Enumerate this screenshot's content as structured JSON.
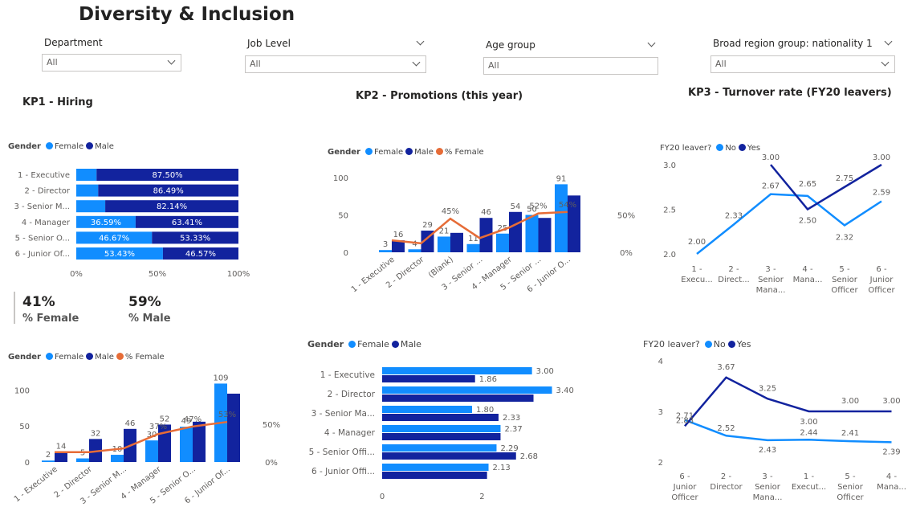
{
  "title": "Diversity & Inclusion",
  "filters": [
    {
      "label": "Department",
      "value": "All"
    },
    {
      "label": "Job Level",
      "value": "All"
    },
    {
      "label": "Age group",
      "value": "All"
    },
    {
      "label": "Broad region group: nationality 1",
      "value": "All"
    }
  ],
  "sections": {
    "kp1": "KP1 - Hiring",
    "kp2": "KP2 - Promotions (this year)",
    "kp3": "KP3 - Turnover rate (FY20 leavers)"
  },
  "colors": {
    "female": "#118dff",
    "male": "#12239e",
    "pct_female": "#e66c37",
    "light_blue": "#8fc4f5",
    "axis_text": "#605e5c"
  },
  "legends": {
    "gender": "Gender",
    "female": "Female",
    "male": "Male",
    "pct_female": "% Female",
    "fy20": "FY20 leaver?",
    "no": "No",
    "yes": "Yes"
  },
  "cards": {
    "female_value": "41%",
    "female_label": "% Female",
    "male_value": "59%",
    "male_label": "% Male"
  },
  "chart_data": [
    {
      "id": "hiring-stacked-100",
      "type": "bar",
      "orientation": "horizontal",
      "stacked_percent": true,
      "categories": [
        "1 - Executive",
        "2 - Director",
        "3 - Senior M...",
        "4 - Manager",
        "5 - Senior O...",
        "6 - Junior Of..."
      ],
      "series": [
        {
          "name": "Female",
          "values": [
            12.5,
            13.51,
            17.86,
            36.59,
            46.67,
            53.43
          ],
          "labels": [
            "",
            "",
            "",
            "36.59%",
            "46.67%",
            "53.43%"
          ]
        },
        {
          "name": "Male",
          "values": [
            87.5,
            86.49,
            82.14,
            63.41,
            53.33,
            46.57
          ],
          "labels": [
            "87.50%",
            "86.49%",
            "82.14%",
            "63.41%",
            "53.33%",
            "46.57%"
          ]
        }
      ],
      "xticks": [
        "0%",
        "50%",
        "100%"
      ],
      "xlim": [
        0,
        100
      ]
    },
    {
      "id": "promotions-combo",
      "type": "bar",
      "categories": [
        "1 - Executive",
        "2 - Director",
        "(Blank)",
        "3 - Senior ...",
        "4 - Manager",
        "5 - Senior ...",
        "6 - Junior O..."
      ],
      "series": [
        {
          "name": "Female",
          "values": [
            3,
            4,
            21,
            11,
            25,
            50,
            91
          ]
        },
        {
          "name": "Male",
          "values": [
            16,
            29,
            26,
            46,
            54,
            46,
            76
          ]
        },
        {
          "name": "% Female",
          "values": [
            16,
            12,
            45,
            19,
            33,
            52,
            54
          ],
          "label_index": {
            "2": "45%",
            "5": "52%",
            "6": "54%"
          }
        }
      ],
      "female_labels": [
        "3",
        "4",
        "21",
        "11",
        "25",
        "50",
        "91"
      ],
      "male_labels": [
        "16",
        "29",
        "",
        "46",
        "54",
        "",
        ""
      ],
      "yticks": [
        "0",
        "50",
        "100"
      ],
      "ylim": [
        0,
        100
      ],
      "y2ticks": [
        "0%",
        "50%"
      ],
      "y2lim": [
        0,
        100
      ]
    },
    {
      "id": "turnover-line-1",
      "type": "line",
      "categories": [
        "1 - Execu...",
        "2 - Direct...",
        "3 - Senior Mana...",
        "4 - Mana...",
        "5 - Senior Officer",
        "6 - Junior Officer"
      ],
      "series": [
        {
          "name": "No",
          "values": [
            2.0,
            2.33,
            2.67,
            2.65,
            2.32,
            2.59
          ]
        },
        {
          "name": "Yes",
          "values": [
            null,
            null,
            3.0,
            2.5,
            2.75,
            3.0
          ]
        }
      ],
      "yticks": [
        "2.0",
        "2.5",
        "3.0"
      ],
      "ylim": [
        2.0,
        3.0
      ]
    },
    {
      "id": "hiring-combo",
      "type": "bar",
      "categories": [
        "1 - Executive",
        "2 - Director",
        "3 - Senior M...",
        "4 - Manager",
        "5 - Senior O...",
        "6 - Junior Of..."
      ],
      "series": [
        {
          "name": "Female",
          "values": [
            2,
            5,
            10,
            30,
            49,
            109
          ]
        },
        {
          "name": "Male",
          "values": [
            14,
            32,
            46,
            52,
            56,
            95
          ]
        },
        {
          "name": "% Female",
          "values": [
            13,
            13,
            18,
            37,
            47,
            53
          ],
          "label_index": {
            "3": "37%",
            "4": "47%",
            "5": "53%"
          }
        }
      ],
      "female_labels": [
        "2",
        "5",
        "10",
        "30",
        "49",
        "109"
      ],
      "male_labels": [
        "14",
        "32",
        "46",
        "52",
        "",
        ""
      ],
      "yticks": [
        "0",
        "50",
        "100"
      ],
      "ylim": [
        0,
        105
      ],
      "y2ticks": [
        "0%",
        "50%"
      ],
      "y2lim": [
        0,
        100
      ]
    },
    {
      "id": "clustered-bar",
      "type": "bar",
      "orientation": "horizontal",
      "categories": [
        "1 - Executive",
        "2 - Director",
        "3 - Senior Ma...",
        "4 - Manager",
        "5 - Senior Offi...",
        "6 - Junior Offi..."
      ],
      "series": [
        {
          "name": "Female",
          "values": [
            3.0,
            3.4,
            1.8,
            2.37,
            2.29,
            2.13
          ]
        },
        {
          "name": "Male",
          "values": [
            1.86,
            3.03,
            2.33,
            2.37,
            2.68,
            2.1
          ]
        }
      ],
      "female_labels": [
        "3.00",
        "3.40",
        "1.80",
        "2.37",
        "2.29",
        "2.13"
      ],
      "male_labels": [
        "1.86",
        "",
        "2.33",
        "",
        "2.68",
        ""
      ],
      "xticks": [
        "0",
        "2"
      ],
      "xlim": [
        0,
        3.6
      ]
    },
    {
      "id": "turnover-line-2",
      "type": "line",
      "categories": [
        "6 - Junior Officer",
        "2 - Director",
        "3 - Senior Mana...",
        "1 - Execut...",
        "5 - Senior Officer",
        "4 - Mana..."
      ],
      "series": [
        {
          "name": "No",
          "values": [
            2.83,
            2.52,
            2.43,
            2.44,
            2.41,
            2.39
          ]
        },
        {
          "name": "Yes",
          "values": [
            2.71,
            3.67,
            3.25,
            3.0,
            3.0,
            3.0
          ]
        }
      ],
      "no_labels": [
        "2.83",
        "2.52",
        "2.43",
        "2.44",
        "2.41",
        "2.39"
      ],
      "yes_labels": [
        "2.71",
        "3.67",
        "3.25",
        "3.00",
        "3.00",
        "3.00"
      ],
      "yticks": [
        "2",
        "3",
        "4"
      ],
      "ylim": [
        2,
        4
      ]
    }
  ]
}
